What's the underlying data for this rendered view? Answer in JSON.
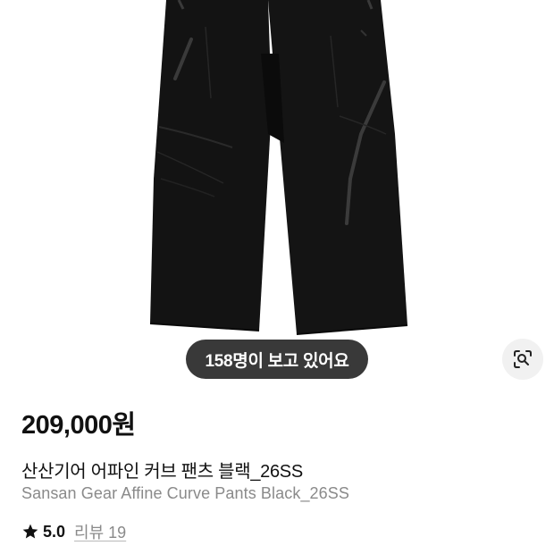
{
  "product": {
    "image_alt": "black cropped wide pants",
    "viewers_text": "158명이 보고 있어요",
    "price": "209,000원",
    "title_ko": "산산기어 어파인 커브 팬츠 블랙_26SS",
    "title_en": "Sansan Gear Affine Curve Pants Black_26SS",
    "rating": "5.0",
    "review_link": "리뷰 19"
  },
  "icons": {
    "lens": "lens-search-icon",
    "star": "star-icon"
  },
  "colors": {
    "pill_bg": "#282828",
    "garment": "#121212",
    "secondary_text": "#8a8a8a"
  }
}
